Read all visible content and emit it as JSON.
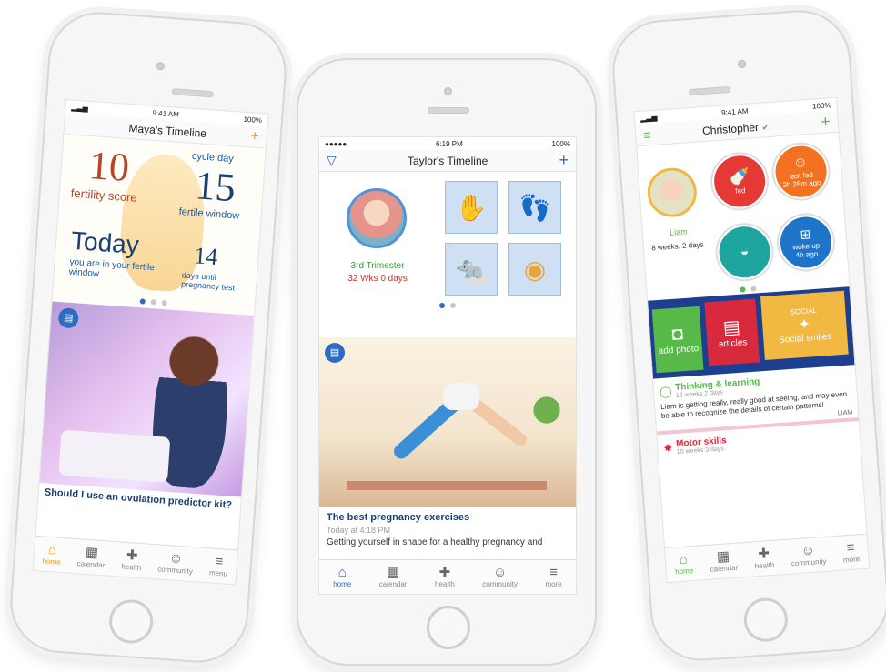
{
  "phone1": {
    "status": {
      "time": "9:41 AM",
      "battery": "100%"
    },
    "title": "Maya's Timeline",
    "add_icon": "plus-icon",
    "fertility_score_value": "10",
    "fertility_score_label": "fertility score",
    "cycle_day_label": "cycle day",
    "cycle_day_value": "15",
    "fertile_window_label": "fertile window",
    "today_label": "Today",
    "today_sub": "you are in your fertile window",
    "days_until_value": "14",
    "days_until_label": "days until pregnancy test",
    "article_title": "Should I use an ovulation predictor kit?",
    "tabs": [
      {
        "label": "home",
        "icon": "home-icon",
        "glyph": "⌂"
      },
      {
        "label": "calendar",
        "icon": "calendar-icon",
        "glyph": "▦"
      },
      {
        "label": "health",
        "icon": "health-icon",
        "glyph": "✚"
      },
      {
        "label": "community",
        "icon": "community-icon",
        "glyph": "☺"
      },
      {
        "label": "menu",
        "icon": "menu-icon",
        "glyph": "≡"
      }
    ]
  },
  "phone2": {
    "status": {
      "carrier": "●●●●● ",
      "time": "6:19 PM",
      "battery": "100%"
    },
    "title": "Taylor's Timeline",
    "filter_icon": "filter-icon",
    "add_icon": "plus-icon",
    "trimester": "3rd Trimester",
    "weeks": "32 Wks 0 days",
    "tiles": [
      {
        "icon": "hand-icon",
        "glyph": "✋"
      },
      {
        "icon": "foot-icon",
        "glyph": "👣"
      },
      {
        "icon": "animal-icon",
        "glyph": "🐀"
      },
      {
        "icon": "baby-icon",
        "glyph": "◉"
      }
    ],
    "article_title": "The best pregnancy exercises",
    "article_time": "Today at 4:18 PM",
    "article_excerpt": "Getting yourself in shape for a healthy pregnancy and",
    "tabs": [
      {
        "label": "home",
        "icon": "home-icon",
        "glyph": "⌂"
      },
      {
        "label": "calendar",
        "icon": "calendar-icon",
        "glyph": "▦"
      },
      {
        "label": "health",
        "icon": "health-icon",
        "glyph": "✚"
      },
      {
        "label": "community",
        "icon": "community-icon",
        "glyph": "☺"
      },
      {
        "label": "more",
        "icon": "menu-icon",
        "glyph": "≡"
      }
    ]
  },
  "phone3": {
    "status": {
      "time": "9:41 AM",
      "battery": "100%"
    },
    "title": "Christopher",
    "add_icon": "plus-icon",
    "menu_icon": "menu-icon",
    "baby_name": "Liam",
    "baby_age": "8 weeks, 2 days",
    "circles": [
      {
        "label": "fed",
        "sub": "",
        "color": "#e53935",
        "icon": "bottle-icon"
      },
      {
        "label": "last fed",
        "sub": "2h 28m ago",
        "color": "#f4721f",
        "icon": "baby-icon"
      },
      {
        "label": "",
        "sub": "",
        "color": "#1ea5a0",
        "icon": "diaper-icon"
      },
      {
        "label": "woke up",
        "sub": "4h ago",
        "color": "#1e74c9",
        "icon": "crib-icon"
      }
    ],
    "cards": [
      {
        "label": "add photo",
        "color": "#57b947",
        "icon": "camera-icon"
      },
      {
        "label": "articles",
        "color": "#d8293d",
        "icon": "book-icon"
      },
      {
        "label": "Social smiles",
        "top": "SOCIAL",
        "color": "#f1b842",
        "icon": "sparkle-icon"
      }
    ],
    "feed": [
      {
        "title": "Thinking & learning",
        "sub": "12 weeks 2 days",
        "text": "Liam is getting really, really good at seeing, and may even be able to recognize the details of certain patterns!",
        "author": "LIAM"
      },
      {
        "title": "Motor skills",
        "sub": "10 weeks 3 days",
        "text": "",
        "author": ""
      }
    ],
    "tabs": [
      {
        "label": "home",
        "icon": "home-icon",
        "glyph": "⌂"
      },
      {
        "label": "calendar",
        "icon": "calendar-icon",
        "glyph": "▦"
      },
      {
        "label": "health",
        "icon": "health-icon",
        "glyph": "✚"
      },
      {
        "label": "community",
        "icon": "community-icon",
        "glyph": "☺"
      },
      {
        "label": "more",
        "icon": "menu-icon",
        "glyph": "≡"
      }
    ]
  }
}
